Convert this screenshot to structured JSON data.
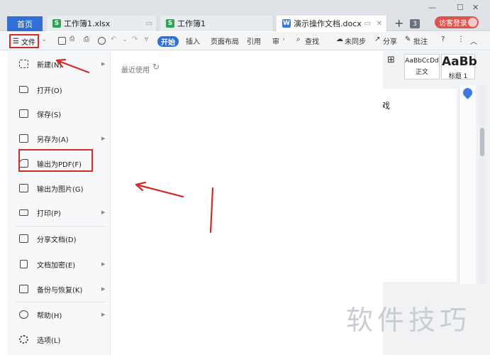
{
  "tabs": {
    "home": "首页",
    "docs": [
      {
        "icon": "S",
        "name": "工作簿1.xlsx"
      },
      {
        "icon": "S",
        "name": "工作簿1"
      },
      {
        "icon": "W",
        "name": "演示操作文档.docx"
      }
    ],
    "new_tab": "+",
    "tab_count": "3",
    "login": "访客登录"
  },
  "ribbon": {
    "file": "文件",
    "start": "开始",
    "insert": "插入",
    "layout": "页面布局",
    "reference": "引用",
    "review_cut": "审",
    "search": "查找",
    "sync": "未同步",
    "share": "分享",
    "comment": "批注"
  },
  "styles": [
    {
      "preview": "AaBbCcDd",
      "name": "正文"
    },
    {
      "preview": "AaBb",
      "name": "标题 1"
    }
  ],
  "document": {
    "visible_text": "戏"
  },
  "file_menu": {
    "items": [
      {
        "label": "新建(N)",
        "icon": "new-file-icon",
        "submenu": true
      },
      {
        "label": "打开(O)",
        "icon": "folder-open-icon",
        "submenu": false
      },
      {
        "label": "保存(S)",
        "icon": "save-icon",
        "submenu": false
      },
      {
        "label": "另存为(A)",
        "icon": "save-as-icon",
        "submenu": true
      },
      {
        "label": "输出为PDF(F)",
        "icon": "pdf-icon",
        "submenu": false
      },
      {
        "label": "输出为图片(G)",
        "icon": "image-icon",
        "submenu": false
      },
      {
        "label": "打印(P)",
        "icon": "print-icon",
        "submenu": true
      },
      {
        "label": "分享文档(D)",
        "icon": "share-icon",
        "submenu": false
      },
      {
        "label": "文档加密(E)",
        "icon": "encrypt-icon",
        "submenu": true
      },
      {
        "label": "备份与恢复(K)",
        "icon": "backup-icon",
        "submenu": true
      },
      {
        "label": "帮助(H)",
        "icon": "help-icon",
        "submenu": true
      },
      {
        "label": "选项(L)",
        "icon": "settings-icon",
        "submenu": false
      }
    ]
  },
  "recent": {
    "label": "最近使用"
  },
  "watermark": "软件技巧",
  "colors": {
    "accent": "#2f6fd6",
    "annotation": "#d32a2a",
    "login": "#e05252"
  }
}
